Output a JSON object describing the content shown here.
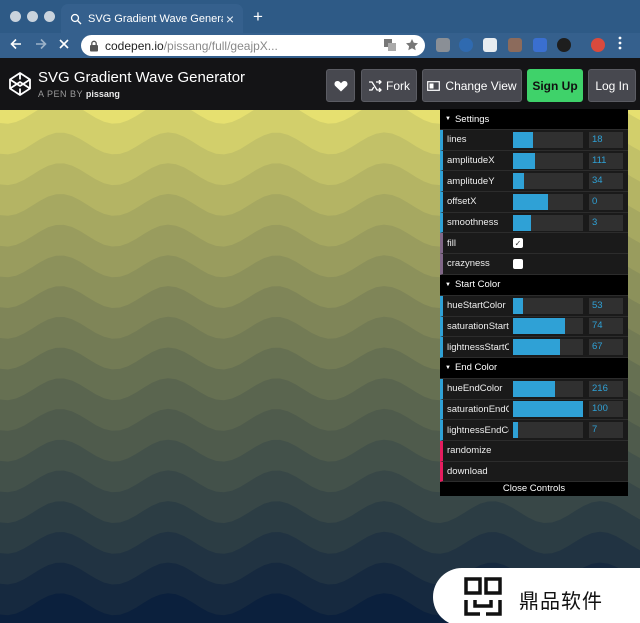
{
  "browser": {
    "tab_title": "SVG Gradient Wave Generator",
    "new_tab_glyph": "+",
    "url_host": "codepen.io",
    "url_path": "/pissang/full/geajpX...",
    "icons": [
      "back-arrow-icon",
      "forward-arrow-icon",
      "stop-icon",
      "lock-icon",
      "translate-icon",
      "bookmark-star-icon"
    ]
  },
  "header": {
    "title": "SVG Gradient Wave Generator",
    "by_prefix": "A PEN BY",
    "author": "pissang",
    "buttons": {
      "fork": "Fork",
      "change_view": "Change View",
      "signup": "Sign Up",
      "login": "Log In"
    }
  },
  "gui": {
    "folders": {
      "settings": "Settings",
      "start_color": "Start Color",
      "end_color": "End Color"
    },
    "settings": [
      {
        "name": "lines",
        "value": "18",
        "fraction": 0.29
      },
      {
        "name": "amplitudeX",
        "value": "111",
        "fraction": 0.32
      },
      {
        "name": "amplitudeY",
        "value": "34",
        "fraction": 0.16
      },
      {
        "name": "offsetX",
        "value": "0",
        "fraction": 0.5
      },
      {
        "name": "smoothness",
        "value": "3",
        "fraction": 0.25
      }
    ],
    "fill": {
      "name": "fill",
      "checked": true
    },
    "crazyness": {
      "name": "crazyness",
      "checked": false
    },
    "start_color": [
      {
        "name": "hueStartColor",
        "value": "53",
        "fraction": 0.14
      },
      {
        "name": "saturationStartColor",
        "value": "74",
        "fraction": 0.74
      },
      {
        "name": "lightnessStartColor",
        "value": "67",
        "fraction": 0.67
      }
    ],
    "end_color": [
      {
        "name": "hueEndColor",
        "value": "216",
        "fraction": 0.6
      },
      {
        "name": "saturationEndColor",
        "value": "100",
        "fraction": 1.0
      },
      {
        "name": "lightnessEndColor",
        "value": "7",
        "fraction": 0.07
      }
    ],
    "actions": {
      "randomize": "randomize",
      "download": "download"
    },
    "close_label": "Close Controls"
  },
  "watermark": {
    "text": "鼎品软件"
  },
  "colors": {
    "start": "#e6e070",
    "end": "#00163a",
    "accent": "#2fa1d6",
    "signup": "#3fd26a"
  }
}
